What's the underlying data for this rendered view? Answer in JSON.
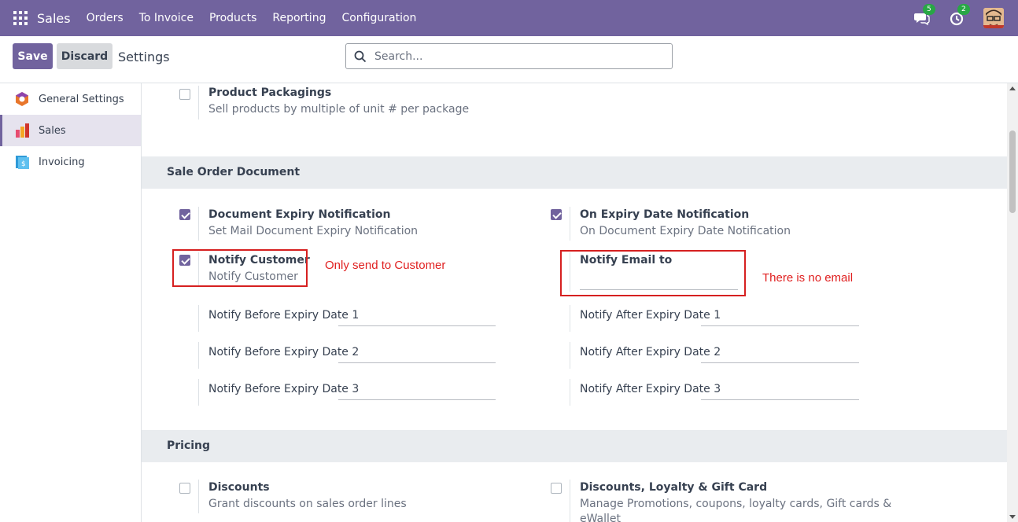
{
  "navbar": {
    "brand": "Sales",
    "menu": [
      "Orders",
      "To Invoice",
      "Products",
      "Reporting",
      "Configuration"
    ],
    "messages_count": "5",
    "activities_count": "2"
  },
  "control": {
    "save_label": "Save",
    "discard_label": "Discard",
    "title": "Settings",
    "search_placeholder": "Search..."
  },
  "sidebar": {
    "items": [
      {
        "label": "General Settings",
        "icon": "general-settings-icon",
        "active": false
      },
      {
        "label": "Sales",
        "icon": "sales-app-icon",
        "active": true
      },
      {
        "label": "Invoicing",
        "icon": "invoicing-app-icon",
        "active": false
      }
    ]
  },
  "settings": {
    "product_packagings": {
      "title": "Product Packagings",
      "description": "Sell products by multiple of unit # per package",
      "checked": false
    },
    "sale_order_document": {
      "heading": "Sale Order Document",
      "doc_expiry": {
        "title": "Document Expiry Notification",
        "description": "Set Mail Document Expiry Notification",
        "checked": true
      },
      "on_expiry": {
        "title": "On Expiry Date Notification",
        "description": "On Document Expiry Date Notification",
        "checked": true
      },
      "notify_customer": {
        "title": "Notify Customer",
        "description": "Notify Customer",
        "checked": true
      },
      "notify_email": {
        "label": "Notify Email to",
        "value": ""
      },
      "before": [
        "Notify Before Expiry Date 1",
        "Notify Before Expiry Date 2",
        "Notify Before Expiry Date 3"
      ],
      "after": [
        "Notify After Expiry Date 1",
        "Notify After Expiry Date 2",
        "Notify After Expiry Date 3"
      ]
    },
    "pricing": {
      "heading": "Pricing",
      "discounts": {
        "title": "Discounts",
        "description": "Grant discounts on sales order lines",
        "checked": false
      },
      "loyalty": {
        "title": "Discounts, Loyalty & Gift Card",
        "description_line1": "Manage Promotions, coupons, loyalty cards, Gift cards &",
        "description_line2": "eWallet",
        "checked": false
      }
    }
  },
  "annotations": {
    "customer_note": "Only send to Customer",
    "email_note": "There is no email"
  },
  "colors": {
    "primary": "#71639e",
    "annotation": "#e02020"
  }
}
